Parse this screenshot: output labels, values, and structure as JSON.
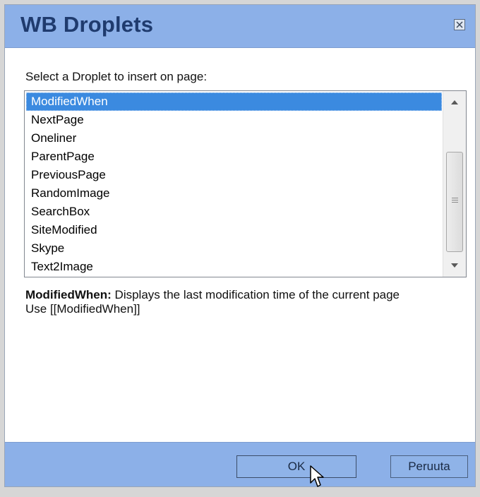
{
  "window": {
    "title": "WB Droplets",
    "close_icon": "close-icon"
  },
  "prompt": "Select a Droplet to insert on page:",
  "droplets": {
    "selected": "ModifiedWhen",
    "items": [
      "ModifiedWhen",
      "NextPage",
      "Oneliner",
      "ParentPage",
      "PreviousPage",
      "RandomImage",
      "SearchBox",
      "SiteModified",
      "Skype",
      "Text2Image"
    ]
  },
  "description": {
    "name": "ModifiedWhen:",
    "text": " Displays the last modification time of the current page",
    "usage": "Use [[ModifiedWhen]]"
  },
  "buttons": {
    "ok": "OK",
    "cancel": "Peruuta"
  },
  "colors": {
    "titlebar": "#8cb0e8",
    "title_text": "#1f3b6e",
    "selection": "#3b8ae0"
  }
}
